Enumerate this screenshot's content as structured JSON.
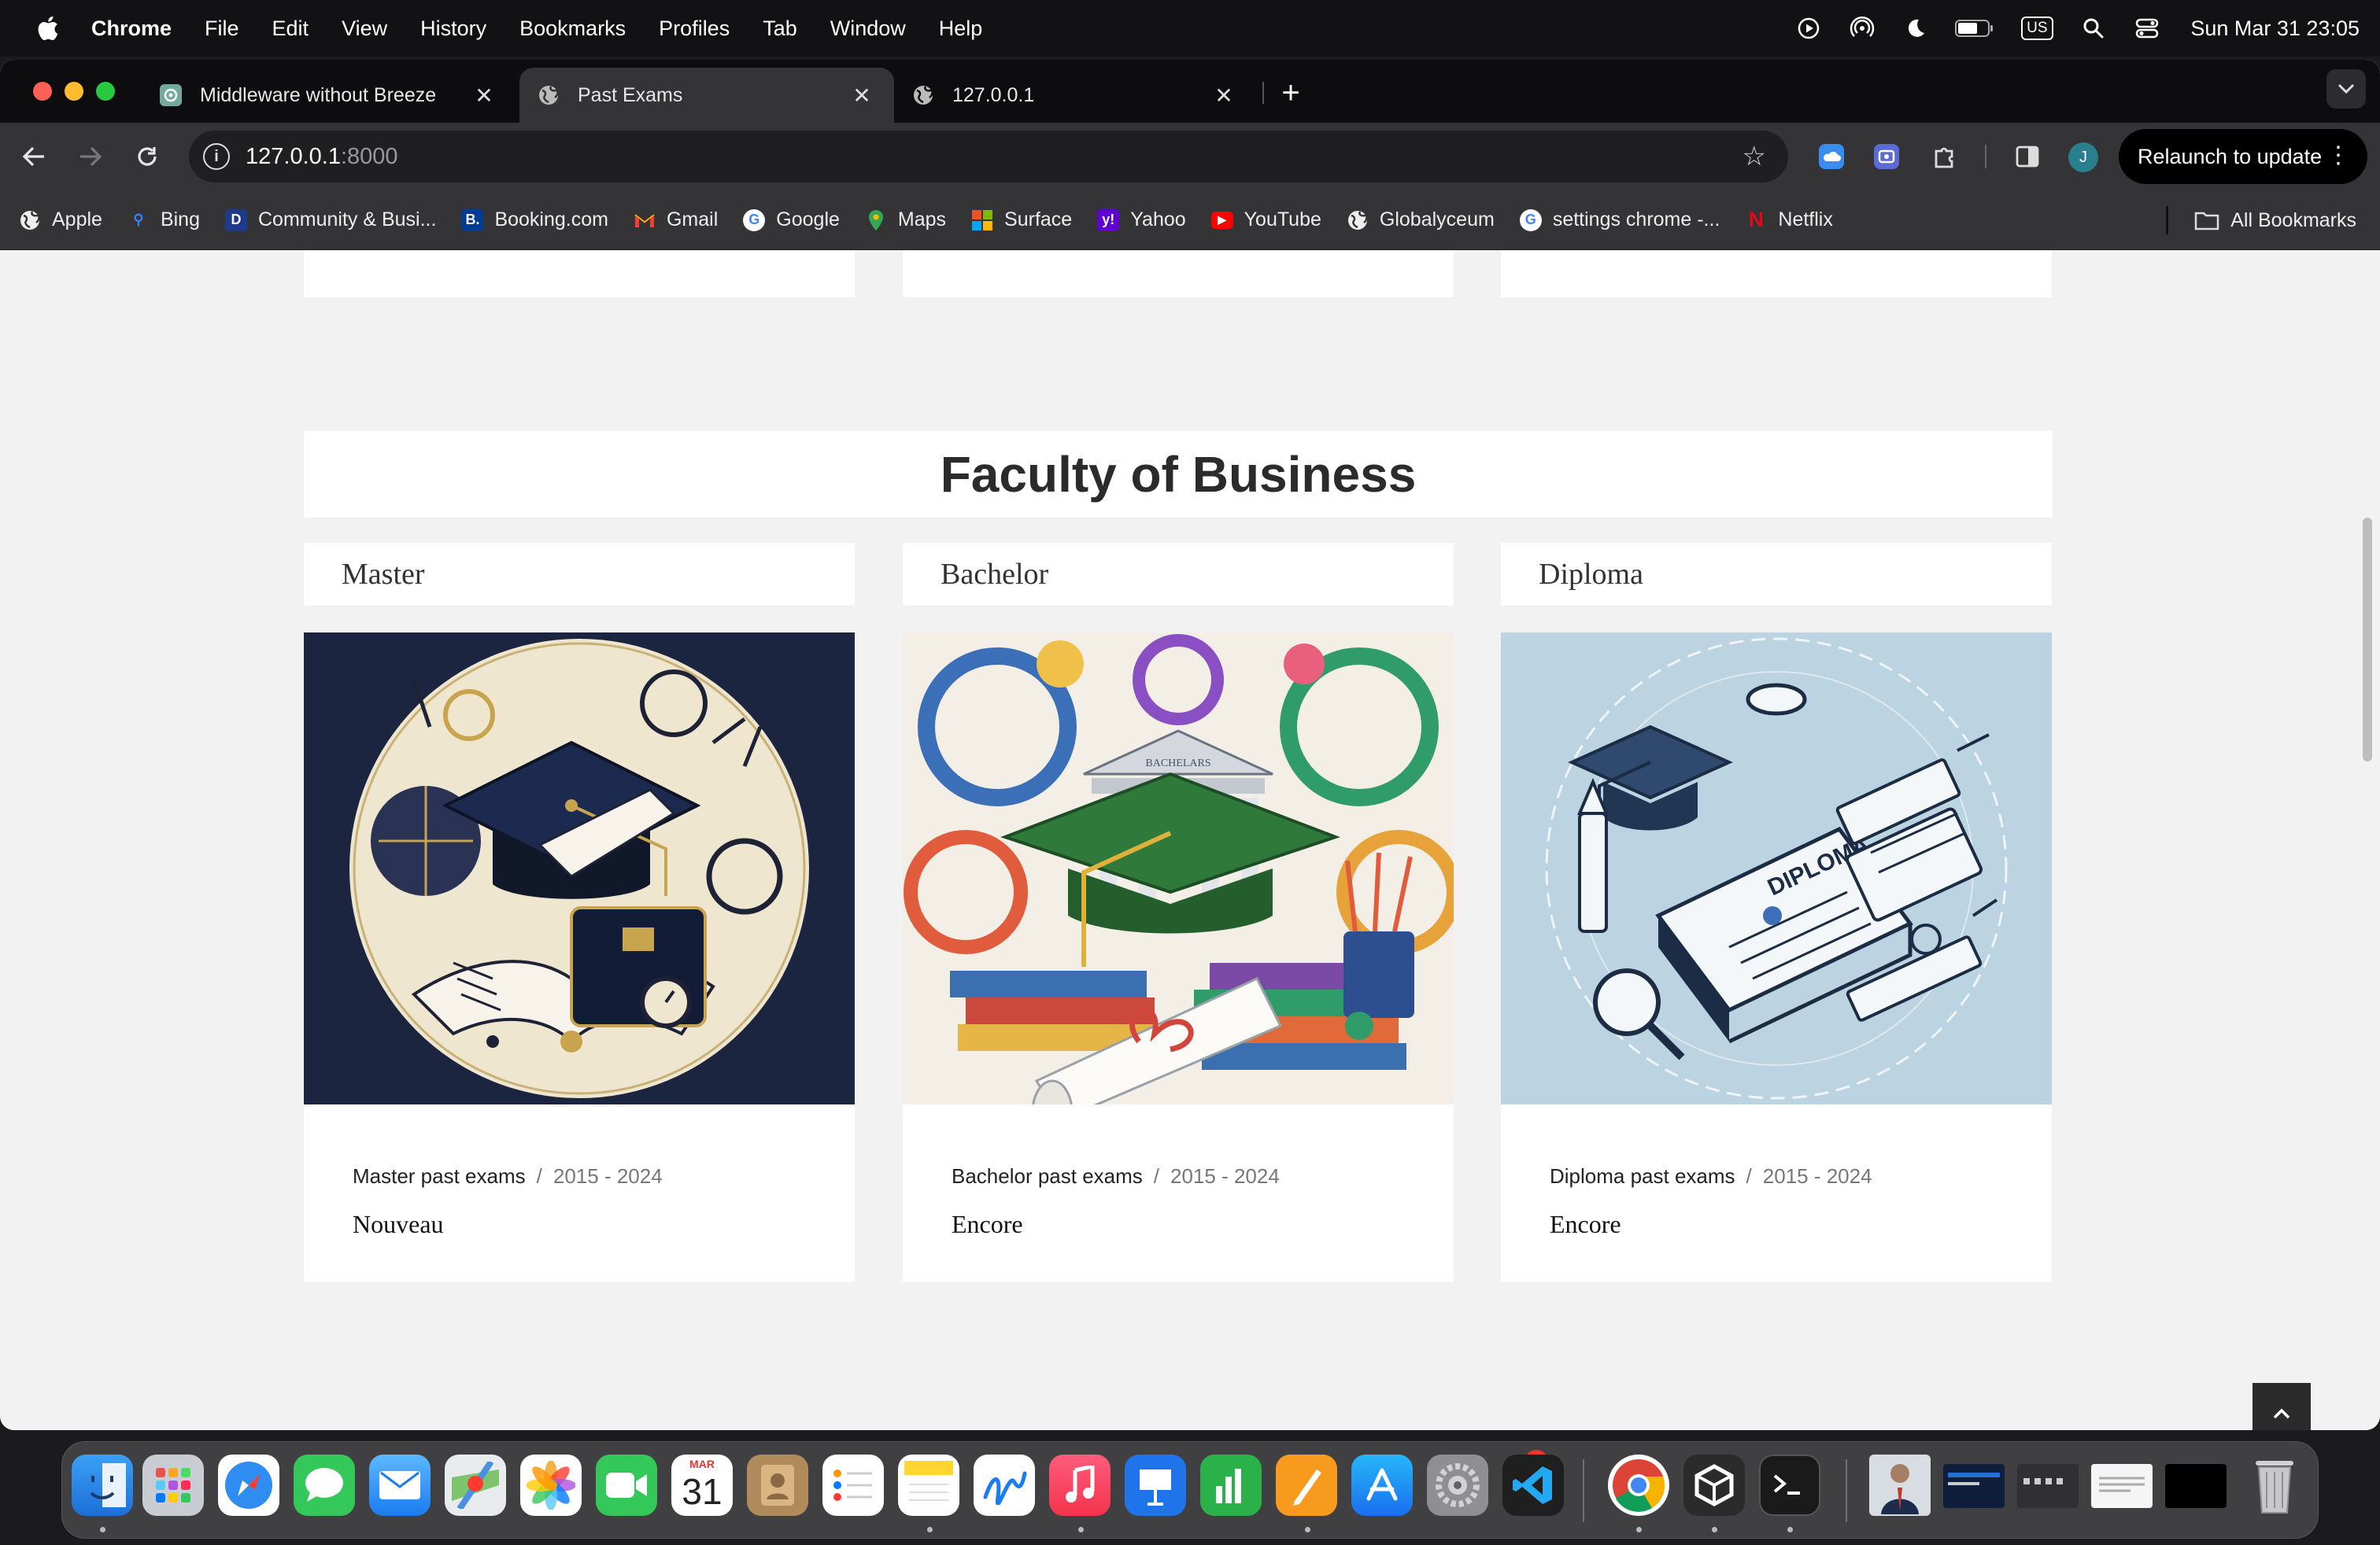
{
  "menubar": {
    "app_name": "Chrome",
    "items": [
      "File",
      "Edit",
      "View",
      "History",
      "Bookmarks",
      "Profiles",
      "Tab",
      "Window",
      "Help"
    ],
    "keyboard_layout": "US",
    "clock": "Sun Mar 31  23:05"
  },
  "tabs": [
    {
      "title": "Middleware without Breeze",
      "icon": "openai-icon",
      "active": false
    },
    {
      "title": "Past Exams",
      "icon": "globe-icon",
      "active": true
    },
    {
      "title": "127.0.0.1",
      "icon": "globe-icon",
      "active": false
    }
  ],
  "omnibox": {
    "host": "127.0.0.1",
    "port": ":8000"
  },
  "toolbar": {
    "relaunch_label": "Relaunch to update",
    "profile_initial": "J"
  },
  "bookmarks": [
    {
      "label": "Apple",
      "icon": "globe-icon"
    },
    {
      "label": "Bing",
      "icon": "bing-icon"
    },
    {
      "label": "Community & Busi...",
      "icon": "community-icon"
    },
    {
      "label": "Booking.com",
      "icon": "booking-icon"
    },
    {
      "label": "Gmail",
      "icon": "gmail-icon"
    },
    {
      "label": "Google",
      "icon": "google-icon"
    },
    {
      "label": "Maps",
      "icon": "maps-icon"
    },
    {
      "label": "Surface",
      "icon": "microsoft-icon"
    },
    {
      "label": "Yahoo",
      "icon": "yahoo-icon"
    },
    {
      "label": "YouTube",
      "icon": "youtube-icon"
    },
    {
      "label": "Globalyceum",
      "icon": "globe-icon"
    },
    {
      "label": "settings chrome -...",
      "icon": "google-icon"
    },
    {
      "label": "Netflix",
      "icon": "netflix-icon"
    }
  ],
  "all_bookmarks_label": "All Bookmarks",
  "page": {
    "faculty_title": "Faculty of Business",
    "cards": [
      {
        "level": "Master",
        "meta": "Master past exams",
        "years": "2015 - 2024",
        "title": "Nouveau",
        "sep": "/"
      },
      {
        "level": "Bachelor",
        "meta": "Bachelor past exams",
        "years": "2015 - 2024",
        "title": "Encore",
        "sep": "/"
      },
      {
        "level": "Diploma",
        "meta": "Diploma past exams",
        "years": "2015 - 2024",
        "title": "Encore",
        "sep": "/"
      }
    ],
    "image_banner_text": "BACHELARS",
    "diploma_image_text": "DIPLOMA"
  },
  "dock": {
    "calendar_month": "MAR",
    "calendar_day": "31",
    "settings_badge": "1"
  },
  "colors": {
    "page_bg": "#f2f2f2",
    "card_bg": "#ffffff",
    "chrome_dark": "#343437",
    "master_bg": "#1c2540",
    "diploma_bg": "#bcd3e2"
  }
}
